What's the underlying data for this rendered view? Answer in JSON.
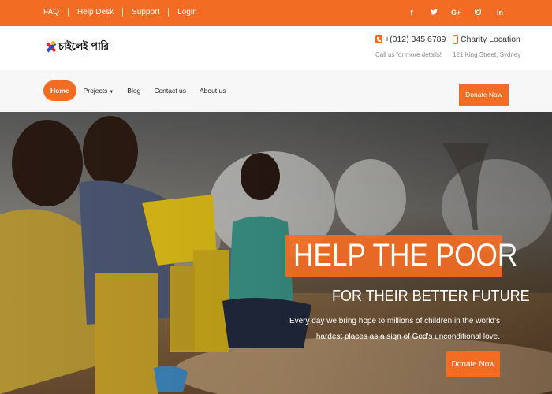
{
  "topbar": {
    "links": [
      "FAQ",
      "Help Desk",
      "Support",
      "Login"
    ],
    "social_icons": [
      {
        "name": "facebook-icon",
        "glyph": "f"
      },
      {
        "name": "twitter-icon",
        "glyph": "🐦"
      },
      {
        "name": "google-plus-icon",
        "glyph": "G+"
      },
      {
        "name": "instagram-icon",
        "glyph": "◎"
      },
      {
        "name": "linkedin-icon",
        "glyph": "in"
      }
    ]
  },
  "header": {
    "logo_text": "চাইলেই পারি",
    "phone": {
      "title": "+(012) 345 6789",
      "subtitle": "Call us for more details!"
    },
    "location": {
      "title": "Charity Location",
      "subtitle": "121 King Street, Sydney"
    }
  },
  "nav": {
    "items": [
      "Home",
      "Projects",
      "Blog",
      "Contact us",
      "About us"
    ],
    "active": "Home",
    "donate_label": "Donate Now"
  },
  "hero": {
    "headline": "HELP THE POOR",
    "subheadline": "FOR THEIR BETTER FUTURE",
    "description": "Every day we bring hope to millions of children in the world's hardest places as a sign of God's unconditional love.",
    "donate_label": "Donate Now"
  },
  "colors": {
    "accent": "#f26c23"
  }
}
